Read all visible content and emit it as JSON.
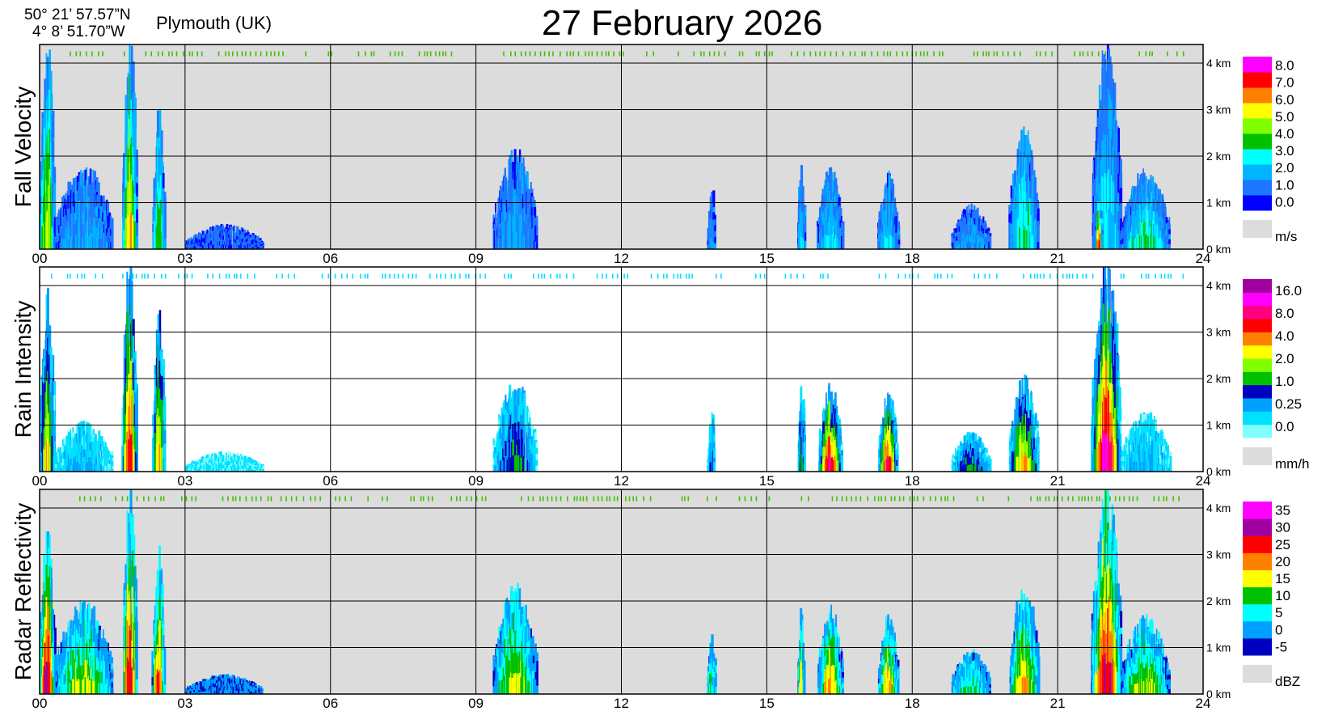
{
  "header": {
    "lat": "50° 21’ 57.57”N",
    "lon": "4°  8’ 51.70”W",
    "location": "Plymouth (UK)",
    "date_title": "27 February  2026"
  },
  "chart_data": [
    {
      "type": "heatmap",
      "title": "Fall Velocity",
      "x_ticks": [
        "00",
        "03",
        "06",
        "09",
        "12",
        "15",
        "18",
        "21",
        "24"
      ],
      "xlim": [
        0,
        24
      ],
      "y_ticks": [
        "0 km",
        "1 km",
        "2 km",
        "3 km",
        "4 km"
      ],
      "ylim": [
        0,
        4.4
      ],
      "grid": true,
      "background": "#dcdcdc",
      "unit": "m/s",
      "legend_values": [
        "0.0",
        "1.0",
        "2.0",
        "3.0",
        "4.0",
        "5.0",
        "6.0",
        "7.0",
        "8.0"
      ],
      "legend_colors": [
        "#0000ff",
        "#1e78ff",
        "#00b4ff",
        "#00ffff",
        "#00c000",
        "#80ff00",
        "#ffff00",
        "#ff8000",
        "#ff0000",
        "#ff00ff"
      ],
      "events": [
        {
          "t": 0.15,
          "w": 0.3,
          "top": 4.3,
          "level": 5
        },
        {
          "t": 0.9,
          "w": 1.2,
          "top": 1.7,
          "level": 1
        },
        {
          "t": 1.85,
          "w": 0.3,
          "top": 4.3,
          "level": 6
        },
        {
          "t": 2.45,
          "w": 0.25,
          "top": 2.8,
          "level": 4
        },
        {
          "t": 3.8,
          "w": 1.6,
          "top": 0.5,
          "level": 0
        },
        {
          "t": 9.8,
          "w": 0.9,
          "top": 2.0,
          "level": 1
        },
        {
          "t": 13.85,
          "w": 0.15,
          "top": 1.3,
          "level": 1
        },
        {
          "t": 15.7,
          "w": 0.15,
          "top": 1.8,
          "level": 2
        },
        {
          "t": 16.3,
          "w": 0.5,
          "top": 1.7,
          "level": 2
        },
        {
          "t": 17.5,
          "w": 0.4,
          "top": 1.6,
          "level": 2
        },
        {
          "t": 19.2,
          "w": 0.8,
          "top": 0.9,
          "level": 1
        },
        {
          "t": 20.3,
          "w": 0.6,
          "top": 2.5,
          "level": 3
        },
        {
          "t": 22.0,
          "w": 0.6,
          "top": 4.3,
          "level": 2
        },
        {
          "t": 22.8,
          "w": 1.0,
          "top": 1.6,
          "level": 3
        },
        {
          "t": 21.85,
          "w": 0.15,
          "top": 1.0,
          "level": 8
        }
      ]
    },
    {
      "type": "heatmap",
      "title": "Rain Intensity",
      "x_ticks": [
        "00",
        "03",
        "06",
        "09",
        "12",
        "15",
        "18",
        "21",
        "24"
      ],
      "xlim": [
        0,
        24
      ],
      "y_ticks": [
        "0 km",
        "1 km",
        "2 km",
        "3 km",
        "4 km"
      ],
      "ylim": [
        0,
        4.4
      ],
      "grid": true,
      "background": "#ffffff",
      "unit": "mm/h",
      "legend_values": [
        "0.0",
        "0.25",
        "1.0",
        "2.0",
        "4.0",
        "8.0",
        "16.0"
      ],
      "legend_colors": [
        "#80ffff",
        "#00e0ff",
        "#00a0ff",
        "#0000c0",
        "#00c000",
        "#80ff00",
        "#ffff00",
        "#ff8000",
        "#ff0000",
        "#ff0080",
        "#ff00ff",
        "#a000a0"
      ],
      "events": [
        {
          "t": 0.15,
          "w": 0.3,
          "top": 3.6,
          "level": 6
        },
        {
          "t": 0.9,
          "w": 1.2,
          "top": 1.0,
          "level": 1
        },
        {
          "t": 1.85,
          "w": 0.3,
          "top": 4.3,
          "level": 8
        },
        {
          "t": 2.45,
          "w": 0.25,
          "top": 3.2,
          "level": 6
        },
        {
          "t": 3.8,
          "w": 1.6,
          "top": 0.4,
          "level": 0
        },
        {
          "t": 9.8,
          "w": 0.9,
          "top": 1.9,
          "level": 3
        },
        {
          "t": 13.85,
          "w": 0.15,
          "top": 1.2,
          "level": 2
        },
        {
          "t": 15.7,
          "w": 0.15,
          "top": 1.7,
          "level": 3
        },
        {
          "t": 16.3,
          "w": 0.5,
          "top": 1.8,
          "level": 8
        },
        {
          "t": 17.5,
          "w": 0.4,
          "top": 1.6,
          "level": 8
        },
        {
          "t": 19.2,
          "w": 0.8,
          "top": 0.8,
          "level": 3
        },
        {
          "t": 20.3,
          "w": 0.6,
          "top": 2.0,
          "level": 6
        },
        {
          "t": 22.0,
          "w": 0.6,
          "top": 4.3,
          "level": 9
        },
        {
          "t": 22.8,
          "w": 1.0,
          "top": 1.2,
          "level": 1
        }
      ]
    },
    {
      "type": "heatmap",
      "title": "Radar Reflectivity",
      "x_ticks": [
        "00",
        "03",
        "06",
        "09",
        "12",
        "15",
        "18",
        "21",
        "24"
      ],
      "xlim": [
        0,
        24
      ],
      "y_ticks": [
        "0 km",
        "1 km",
        "2 km",
        "3 km",
        "4 km"
      ],
      "ylim": [
        0,
        4.4
      ],
      "grid": true,
      "background": "#dcdcdc",
      "unit": "dBZ",
      "legend_values": [
        "-5",
        "0",
        "5",
        "10",
        "15",
        "20",
        "25",
        "30",
        "35"
      ],
      "legend_colors": [
        "#0000c0",
        "#00a0ff",
        "#00ffff",
        "#00c000",
        "#ffff00",
        "#ff8000",
        "#ff0000",
        "#a000a0",
        "#ff00ff"
      ],
      "events": [
        {
          "t": 0.15,
          "w": 0.3,
          "top": 3.3,
          "level": 6
        },
        {
          "t": 0.9,
          "w": 1.2,
          "top": 1.9,
          "level": 3
        },
        {
          "t": 1.85,
          "w": 0.3,
          "top": 4.3,
          "level": 6
        },
        {
          "t": 2.45,
          "w": 0.25,
          "top": 3.0,
          "level": 5
        },
        {
          "t": 3.8,
          "w": 1.6,
          "top": 0.4,
          "level": 0
        },
        {
          "t": 9.8,
          "w": 0.9,
          "top": 2.2,
          "level": 3
        },
        {
          "t": 13.85,
          "w": 0.15,
          "top": 1.3,
          "level": 2
        },
        {
          "t": 15.7,
          "w": 0.15,
          "top": 1.8,
          "level": 4
        },
        {
          "t": 16.3,
          "w": 0.5,
          "top": 1.8,
          "level": 4
        },
        {
          "t": 17.5,
          "w": 0.4,
          "top": 1.6,
          "level": 4
        },
        {
          "t": 19.2,
          "w": 0.8,
          "top": 0.9,
          "level": 2
        },
        {
          "t": 20.3,
          "w": 0.6,
          "top": 2.2,
          "level": 4
        },
        {
          "t": 22.0,
          "w": 0.6,
          "top": 4.3,
          "level": 6
        },
        {
          "t": 22.8,
          "w": 1.0,
          "top": 1.6,
          "level": 3
        }
      ]
    }
  ]
}
